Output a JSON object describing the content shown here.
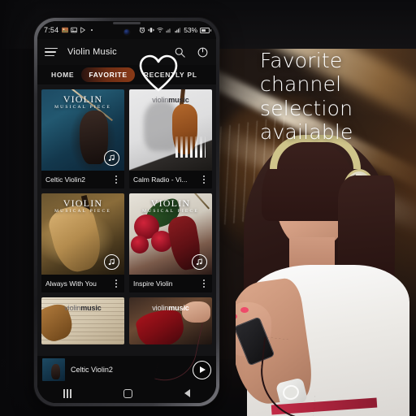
{
  "promo": {
    "lines": [
      "Favorite",
      "channel",
      "selection",
      "available"
    ]
  },
  "phone": {
    "statusbar": {
      "time": "7:54",
      "battery_text": "53%",
      "left_icons": [
        "photo-icon",
        "gallery-icon",
        "play-store-icon",
        "dot-icon"
      ],
      "right_icons": [
        "alarm-icon",
        "vibrate-icon",
        "wifi-icon",
        "signal-icon",
        "signal-bars-icon"
      ]
    },
    "appbar": {
      "menu_icon": "hamburger-icon",
      "title": "Violin Music",
      "search_icon": "search-icon",
      "power_icon": "power-icon"
    },
    "tabs": [
      {
        "label": "HOME",
        "active": false
      },
      {
        "label": "FAVORITE",
        "active": true
      },
      {
        "label": "RECENTLY PL",
        "active": false
      }
    ],
    "cards": [
      {
        "title": "Celtic Violin2",
        "art_style": "celtic",
        "overlay_type": "serif",
        "overlay_line1": "VIOLIN",
        "overlay_line2": "MUSICAL PIECE",
        "badge": "music-note-icon"
      },
      {
        "title": "Calm Radio - Vi...",
        "art_style": "calm",
        "overlay_type": "logo",
        "logo_light": "violin",
        "logo_bold": "music",
        "badge": "equalizer-icon"
      },
      {
        "title": "Always With You",
        "art_style": "always",
        "overlay_type": "serif",
        "overlay_line1": "VIOLIN",
        "overlay_line2": "MUSICAL PIECE",
        "badge": "music-note-icon"
      },
      {
        "title": "Inspire Violin",
        "art_style": "inspire",
        "overlay_type": "serif",
        "overlay_line1": "VIOLIN",
        "overlay_line2": "MUSICAL PIECE",
        "badge": "music-note-icon"
      }
    ],
    "cards_partial": [
      {
        "art_style": "sheet",
        "logo_light": "violin",
        "logo_bold": "music"
      },
      {
        "art_style": "red",
        "logo_light": "violin",
        "logo_bold": "music"
      }
    ],
    "nowplaying": {
      "title": "Celtic Violin2",
      "play_icon": "play-icon",
      "thumb": "album-thumbnail"
    },
    "navbar": {
      "recents": "recents-icon",
      "home": "home-icon",
      "back": "back-icon"
    },
    "callout": {
      "icon": "heart-outline-icon"
    }
  },
  "colors": {
    "accent": "#8a3a17",
    "app_bg": "#0e0e0f",
    "card_bg": "#0a0a0b",
    "text": "#efefef"
  }
}
